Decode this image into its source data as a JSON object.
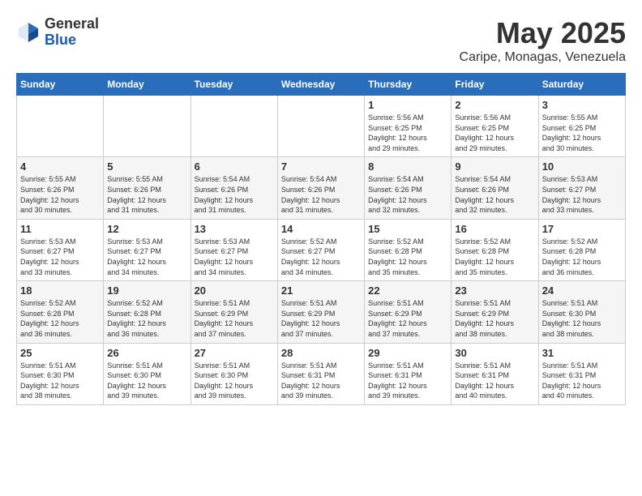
{
  "logo": {
    "general": "General",
    "blue": "Blue"
  },
  "title": "May 2025",
  "location": "Caripe, Monagas, Venezuela",
  "weekdays": [
    "Sunday",
    "Monday",
    "Tuesday",
    "Wednesday",
    "Thursday",
    "Friday",
    "Saturday"
  ],
  "weeks": [
    [
      {
        "day": "",
        "info": ""
      },
      {
        "day": "",
        "info": ""
      },
      {
        "day": "",
        "info": ""
      },
      {
        "day": "",
        "info": ""
      },
      {
        "day": "1",
        "info": "Sunrise: 5:56 AM\nSunset: 6:25 PM\nDaylight: 12 hours\nand 29 minutes."
      },
      {
        "day": "2",
        "info": "Sunrise: 5:56 AM\nSunset: 6:25 PM\nDaylight: 12 hours\nand 29 minutes."
      },
      {
        "day": "3",
        "info": "Sunrise: 5:55 AM\nSunset: 6:25 PM\nDaylight: 12 hours\nand 30 minutes."
      }
    ],
    [
      {
        "day": "4",
        "info": "Sunrise: 5:55 AM\nSunset: 6:26 PM\nDaylight: 12 hours\nand 30 minutes."
      },
      {
        "day": "5",
        "info": "Sunrise: 5:55 AM\nSunset: 6:26 PM\nDaylight: 12 hours\nand 31 minutes."
      },
      {
        "day": "6",
        "info": "Sunrise: 5:54 AM\nSunset: 6:26 PM\nDaylight: 12 hours\nand 31 minutes."
      },
      {
        "day": "7",
        "info": "Sunrise: 5:54 AM\nSunset: 6:26 PM\nDaylight: 12 hours\nand 31 minutes."
      },
      {
        "day": "8",
        "info": "Sunrise: 5:54 AM\nSunset: 6:26 PM\nDaylight: 12 hours\nand 32 minutes."
      },
      {
        "day": "9",
        "info": "Sunrise: 5:54 AM\nSunset: 6:26 PM\nDaylight: 12 hours\nand 32 minutes."
      },
      {
        "day": "10",
        "info": "Sunrise: 5:53 AM\nSunset: 6:27 PM\nDaylight: 12 hours\nand 33 minutes."
      }
    ],
    [
      {
        "day": "11",
        "info": "Sunrise: 5:53 AM\nSunset: 6:27 PM\nDaylight: 12 hours\nand 33 minutes."
      },
      {
        "day": "12",
        "info": "Sunrise: 5:53 AM\nSunset: 6:27 PM\nDaylight: 12 hours\nand 34 minutes."
      },
      {
        "day": "13",
        "info": "Sunrise: 5:53 AM\nSunset: 6:27 PM\nDaylight: 12 hours\nand 34 minutes."
      },
      {
        "day": "14",
        "info": "Sunrise: 5:52 AM\nSunset: 6:27 PM\nDaylight: 12 hours\nand 34 minutes."
      },
      {
        "day": "15",
        "info": "Sunrise: 5:52 AM\nSunset: 6:28 PM\nDaylight: 12 hours\nand 35 minutes."
      },
      {
        "day": "16",
        "info": "Sunrise: 5:52 AM\nSunset: 6:28 PM\nDaylight: 12 hours\nand 35 minutes."
      },
      {
        "day": "17",
        "info": "Sunrise: 5:52 AM\nSunset: 6:28 PM\nDaylight: 12 hours\nand 36 minutes."
      }
    ],
    [
      {
        "day": "18",
        "info": "Sunrise: 5:52 AM\nSunset: 6:28 PM\nDaylight: 12 hours\nand 36 minutes."
      },
      {
        "day": "19",
        "info": "Sunrise: 5:52 AM\nSunset: 6:28 PM\nDaylight: 12 hours\nand 36 minutes."
      },
      {
        "day": "20",
        "info": "Sunrise: 5:51 AM\nSunset: 6:29 PM\nDaylight: 12 hours\nand 37 minutes."
      },
      {
        "day": "21",
        "info": "Sunrise: 5:51 AM\nSunset: 6:29 PM\nDaylight: 12 hours\nand 37 minutes."
      },
      {
        "day": "22",
        "info": "Sunrise: 5:51 AM\nSunset: 6:29 PM\nDaylight: 12 hours\nand 37 minutes."
      },
      {
        "day": "23",
        "info": "Sunrise: 5:51 AM\nSunset: 6:29 PM\nDaylight: 12 hours\nand 38 minutes."
      },
      {
        "day": "24",
        "info": "Sunrise: 5:51 AM\nSunset: 6:30 PM\nDaylight: 12 hours\nand 38 minutes."
      }
    ],
    [
      {
        "day": "25",
        "info": "Sunrise: 5:51 AM\nSunset: 6:30 PM\nDaylight: 12 hours\nand 38 minutes."
      },
      {
        "day": "26",
        "info": "Sunrise: 5:51 AM\nSunset: 6:30 PM\nDaylight: 12 hours\nand 39 minutes."
      },
      {
        "day": "27",
        "info": "Sunrise: 5:51 AM\nSunset: 6:30 PM\nDaylight: 12 hours\nand 39 minutes."
      },
      {
        "day": "28",
        "info": "Sunrise: 5:51 AM\nSunset: 6:31 PM\nDaylight: 12 hours\nand 39 minutes."
      },
      {
        "day": "29",
        "info": "Sunrise: 5:51 AM\nSunset: 6:31 PM\nDaylight: 12 hours\nand 39 minutes."
      },
      {
        "day": "30",
        "info": "Sunrise: 5:51 AM\nSunset: 6:31 PM\nDaylight: 12 hours\nand 40 minutes."
      },
      {
        "day": "31",
        "info": "Sunrise: 5:51 AM\nSunset: 6:31 PM\nDaylight: 12 hours\nand 40 minutes."
      }
    ]
  ]
}
